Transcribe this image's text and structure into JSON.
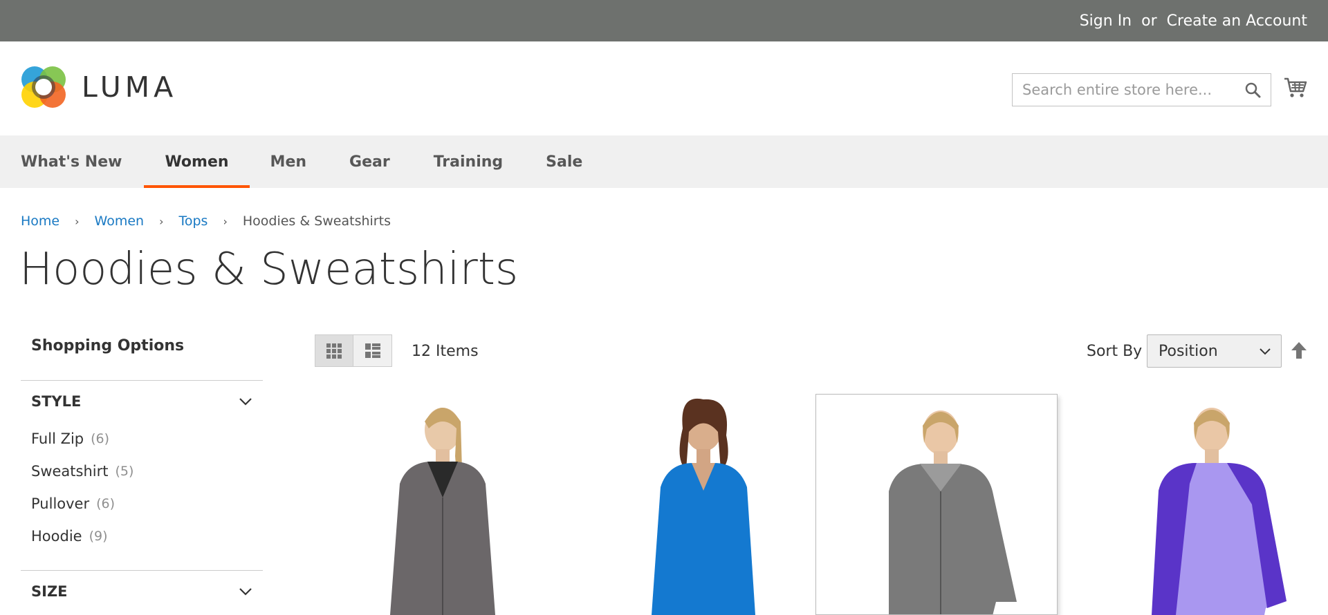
{
  "topbar": {
    "sign_in": "Sign In",
    "or": "or",
    "create_account": "Create an Account"
  },
  "header": {
    "logo_text": "LUMA",
    "search_placeholder": "Search entire store here..."
  },
  "nav": {
    "items": [
      "What's New",
      "Women",
      "Men",
      "Gear",
      "Training",
      "Sale"
    ],
    "active": "Women"
  },
  "breadcrumb": {
    "home": "Home",
    "women": "Women",
    "tops": "Tops",
    "current": "Hoodies & Sweatshirts"
  },
  "page_title": "Hoodies & Sweatshirts",
  "sidebar": {
    "title": "Shopping Options",
    "style": {
      "title": "STYLE",
      "options": [
        {
          "label": "Full Zip",
          "count": "(6)"
        },
        {
          "label": "Sweatshirt",
          "count": "(5)"
        },
        {
          "label": "Pullover",
          "count": "(6)"
        },
        {
          "label": "Hoodie",
          "count": "(9)"
        }
      ]
    },
    "size": {
      "title": "SIZE"
    }
  },
  "toolbar": {
    "items_count": "12 Items",
    "sort_label": "Sort By",
    "sort_value": "Position"
  },
  "colors": {
    "accent": "#ff5501",
    "link": "#1979c3",
    "topbar": "#6e716e",
    "nav_bg": "#f0f0f0"
  },
  "products": [
    {
      "name": "product-1",
      "color": "#6b6769"
    },
    {
      "name": "product-2",
      "color": "#1479d0"
    },
    {
      "name": "product-3",
      "color": "#7a7a7a"
    },
    {
      "name": "product-4",
      "color": "#a997f0"
    }
  ]
}
